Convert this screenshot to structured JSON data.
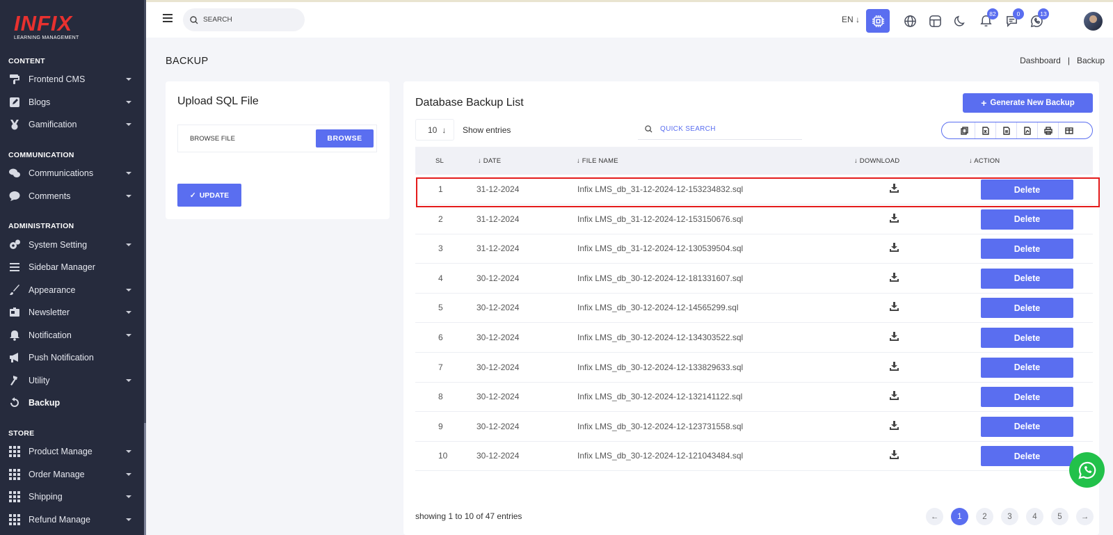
{
  "sidebar": {
    "brand": "INFIX",
    "tagline": "LEARNING MANAGEMENT",
    "sections": {
      "content": "CONTENT",
      "communication": "COMMUNICATION",
      "administration": "ADMINISTRATION",
      "store": "STORE"
    },
    "items": [
      {
        "label": "Frontend CMS",
        "icon": "paint-roller-icon"
      },
      {
        "label": "Blogs",
        "icon": "pencil-square-icon"
      },
      {
        "label": "Gamification",
        "icon": "medal-icon"
      },
      {
        "label": "Communications",
        "icon": "chat-bubbles-icon"
      },
      {
        "label": "Comments",
        "icon": "comment-icon"
      },
      {
        "label": "System Setting",
        "icon": "gears-icon"
      },
      {
        "label": "Sidebar Manager",
        "icon": "bars-icon"
      },
      {
        "label": "Appearance",
        "icon": "brush-icon"
      },
      {
        "label": "Newsletter",
        "icon": "newsletter-icon"
      },
      {
        "label": "Notification",
        "icon": "bell-icon"
      },
      {
        "label": "Push Notification",
        "icon": "megaphone-icon"
      },
      {
        "label": "Utility",
        "icon": "hammer-icon"
      },
      {
        "label": "Backup",
        "icon": "backup-icon"
      },
      {
        "label": "Product Manage",
        "icon": "grid-icon"
      },
      {
        "label": "Order Manage",
        "icon": "grid-icon"
      },
      {
        "label": "Shipping",
        "icon": "grid-icon"
      },
      {
        "label": "Refund Manage",
        "icon": "grid-icon"
      }
    ]
  },
  "topbar": {
    "search_placeholder": "SEARCH",
    "language": "EN",
    "badges": {
      "notifications": "82",
      "messages": "0",
      "whatsapp": "13"
    }
  },
  "page": {
    "title": "BACKUP",
    "breadcrumb": [
      "Dashboard",
      "Backup"
    ]
  },
  "upload": {
    "title": "Upload SQL File",
    "file_placeholder": "BROWSE FILE",
    "browse_label": "BROWSE",
    "update_label": "UPDATE"
  },
  "backup_list": {
    "title": "Database Backup List",
    "generate_label": "Generate New Backup",
    "entries_value": "10",
    "entries_label": "Show entries",
    "quick_search": "QUICK SEARCH",
    "columns": {
      "sl": "SL",
      "date": "DATE",
      "file_name": "FILE NAME",
      "download": "DOWNLOAD",
      "action": "ACTION"
    },
    "delete_label": "Delete",
    "rows": [
      {
        "sl": "1",
        "date": "31-12-2024",
        "file": "Infix LMS_db_31-12-2024-12-153234832.sql"
      },
      {
        "sl": "2",
        "date": "31-12-2024",
        "file": "Infix LMS_db_31-12-2024-12-153150676.sql"
      },
      {
        "sl": "3",
        "date": "31-12-2024",
        "file": "Infix LMS_db_31-12-2024-12-130539504.sql"
      },
      {
        "sl": "4",
        "date": "30-12-2024",
        "file": "Infix LMS_db_30-12-2024-12-181331607.sql"
      },
      {
        "sl": "5",
        "date": "30-12-2024",
        "file": "Infix LMS_db_30-12-2024-12-14565299.sql"
      },
      {
        "sl": "6",
        "date": "30-12-2024",
        "file": "Infix LMS_db_30-12-2024-12-134303522.sql"
      },
      {
        "sl": "7",
        "date": "30-12-2024",
        "file": "Infix LMS_db_30-12-2024-12-133829633.sql"
      },
      {
        "sl": "8",
        "date": "30-12-2024",
        "file": "Infix LMS_db_30-12-2024-12-132141122.sql"
      },
      {
        "sl": "9",
        "date": "30-12-2024",
        "file": "Infix LMS_db_30-12-2024-12-123731558.sql"
      },
      {
        "sl": "10",
        "date": "30-12-2024",
        "file": "Infix LMS_db_30-12-2024-12-121043484.sql"
      }
    ],
    "showing": "showing 1 to 10 of 47 entries",
    "pages": [
      "1",
      "2",
      "3",
      "4",
      "5"
    ]
  },
  "colors": {
    "accent": "#5a6ef0",
    "sidebar": "#262b3d",
    "highlight": "#e41b1b",
    "whatsapp": "#22c14a"
  }
}
